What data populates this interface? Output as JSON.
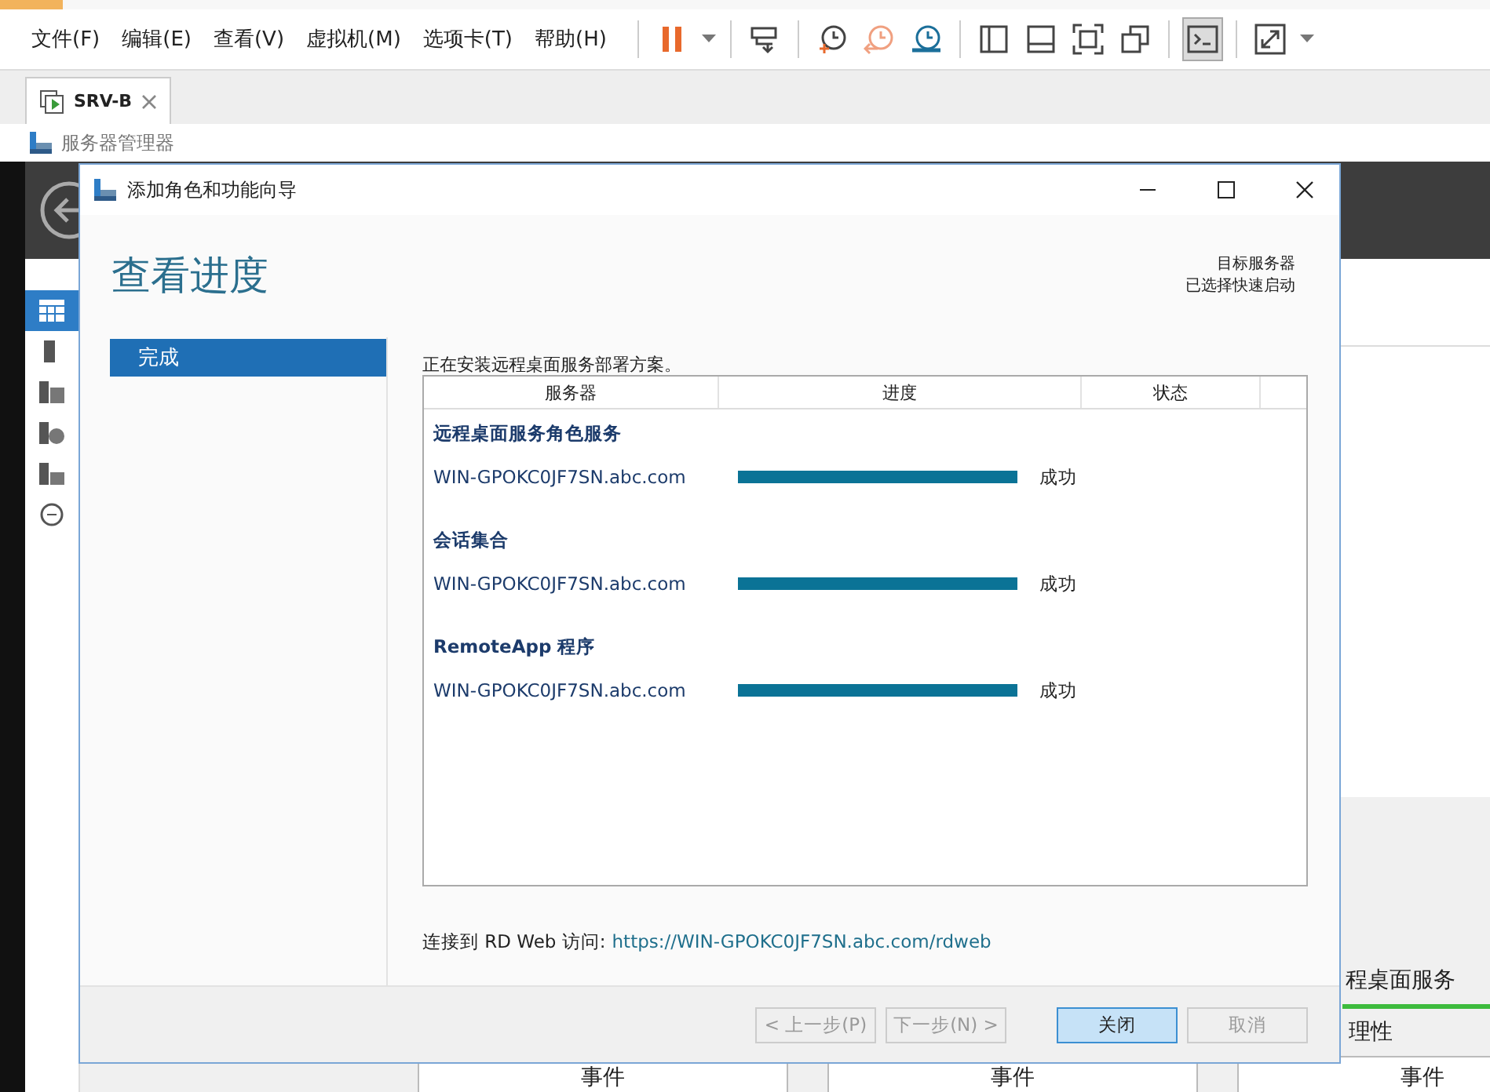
{
  "menu": [
    "文件(F)",
    "编辑(E)",
    "查看(V)",
    "虚拟机(M)",
    "选项卡(T)",
    "帮助(H)"
  ],
  "toolbar": [
    [
      {
        "kind": "pause",
        "pressed": false
      },
      {
        "kind": "caret",
        "pressed": false
      }
    ],
    [
      {
        "kind": "send-keys",
        "pressed": false
      }
    ],
    [
      {
        "kind": "snapshot",
        "pressed": false
      },
      {
        "kind": "revert",
        "pressed": false
      },
      {
        "kind": "manage",
        "pressed": false
      }
    ],
    [
      {
        "kind": "sidebar",
        "pressed": false
      },
      {
        "kind": "bottom",
        "pressed": false
      },
      {
        "kind": "fullscreen",
        "pressed": false
      },
      {
        "kind": "windows",
        "pressed": false
      }
    ],
    [
      {
        "kind": "console",
        "pressed": true
      }
    ],
    [
      {
        "kind": "stretch",
        "pressed": false
      },
      {
        "kind": "caret",
        "pressed": false
      }
    ]
  ],
  "vm_tab": {
    "label": "SRV-B"
  },
  "app_title": "服务器管理器",
  "sidebar_items": [
    {
      "kind": "dashboard",
      "selected": true
    },
    {
      "kind": "server",
      "selected": false
    },
    {
      "kind": "servers",
      "selected": false
    },
    {
      "kind": "files",
      "selected": false
    },
    {
      "kind": "remote",
      "selected": false
    },
    {
      "kind": "circle",
      "selected": false
    }
  ],
  "background": {
    "heading": "程桌面服务",
    "label": "理性",
    "panels": [
      "事件",
      "事件",
      "事件"
    ]
  },
  "dialog": {
    "title": "添加角色和功能向导",
    "heading": "查看进度",
    "destination": [
      "目标服务器",
      "已选择快速启动"
    ],
    "steps": [
      {
        "label": "完成",
        "selected": true
      }
    ],
    "intro": "正在安装远程桌面服务部署方案。",
    "columns": [
      "服务器",
      "进度",
      "状态"
    ],
    "groups": [
      {
        "name": "远程桌面服务角色服务",
        "rows": [
          {
            "server": "WIN-GPOKC0JF7SN.abc.com",
            "level": 1,
            "status": "成功"
          }
        ]
      },
      {
        "name": "会话集合",
        "rows": [
          {
            "server": "WIN-GPOKC0JF7SN.abc.com",
            "level": 1,
            "status": "成功"
          }
        ]
      },
      {
        "name": "RemoteApp 程序",
        "rows": [
          {
            "server": "WIN-GPOKC0JF7SN.abc.com",
            "level": 1,
            "status": "成功"
          }
        ]
      }
    ],
    "link_label": "连接到 RD Web 访问:",
    "link": "https://WIN-GPOKC0JF7SN.abc.com/rdweb",
    "buttons": [
      {
        "label": "< 上一步(P)",
        "disabled": true,
        "default": false
      },
      {
        "label": "下一步(N) >",
        "disabled": true,
        "default": false
      },
      {
        "label": "关闭",
        "disabled": false,
        "default": true
      },
      {
        "label": "取消",
        "disabled": true,
        "default": false
      }
    ]
  }
}
